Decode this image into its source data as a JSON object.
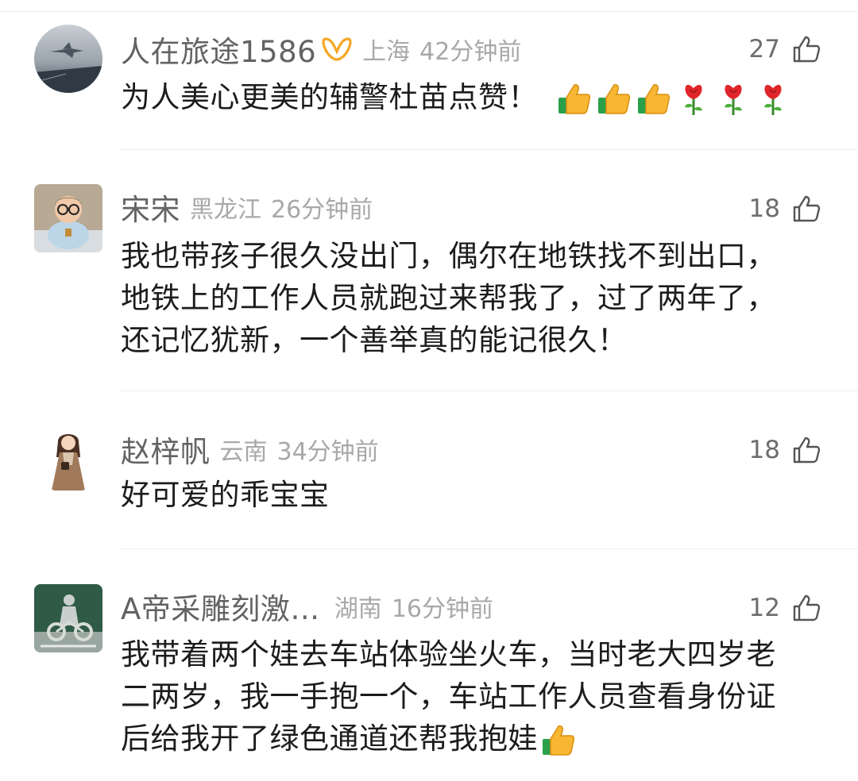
{
  "comments": [
    {
      "username": "人在旅途1586",
      "location": "上海",
      "time": "42分钟前",
      "likes": "27",
      "text": "为人美心更美的辅警杜苗点赞！",
      "badge": "vip-ribbon-icon",
      "emojis": [
        "thumbs-up",
        "thumbs-up",
        "thumbs-up",
        "rose",
        "rose",
        "rose"
      ]
    },
    {
      "username": "宋宋",
      "location": "黑龙江",
      "time": "26分钟前",
      "likes": "18",
      "lines": [
        "我也带孩子很久没出门，偶尔在地铁找不到出口，",
        "地铁上的工作人员就跑过来帮我了，过了两年了，",
        "还记忆犹新，一个善举真的能记很久！"
      ]
    },
    {
      "username": "赵梓帆",
      "location": "云南",
      "time": "34分钟前",
      "likes": "18",
      "text": "好可爱的乖宝宝"
    },
    {
      "username": "A帝采雕刻激…",
      "location": "湖南",
      "time": "16分钟前",
      "likes": "12",
      "lines": [
        "我带着两个娃去车站体验坐火车，当时老大四岁老",
        "二两岁，我一手抱一个，车站工作人员查看身份证",
        "后给我开了绿色通道还帮我抱娃"
      ],
      "trailing_emoji": "thumbs-up"
    }
  ],
  "colors": {
    "username": "#636363",
    "meta": "#a8a8a8",
    "body": "#1c1c1c",
    "divider": "#ececec",
    "vip_badge": "#f5a623"
  }
}
